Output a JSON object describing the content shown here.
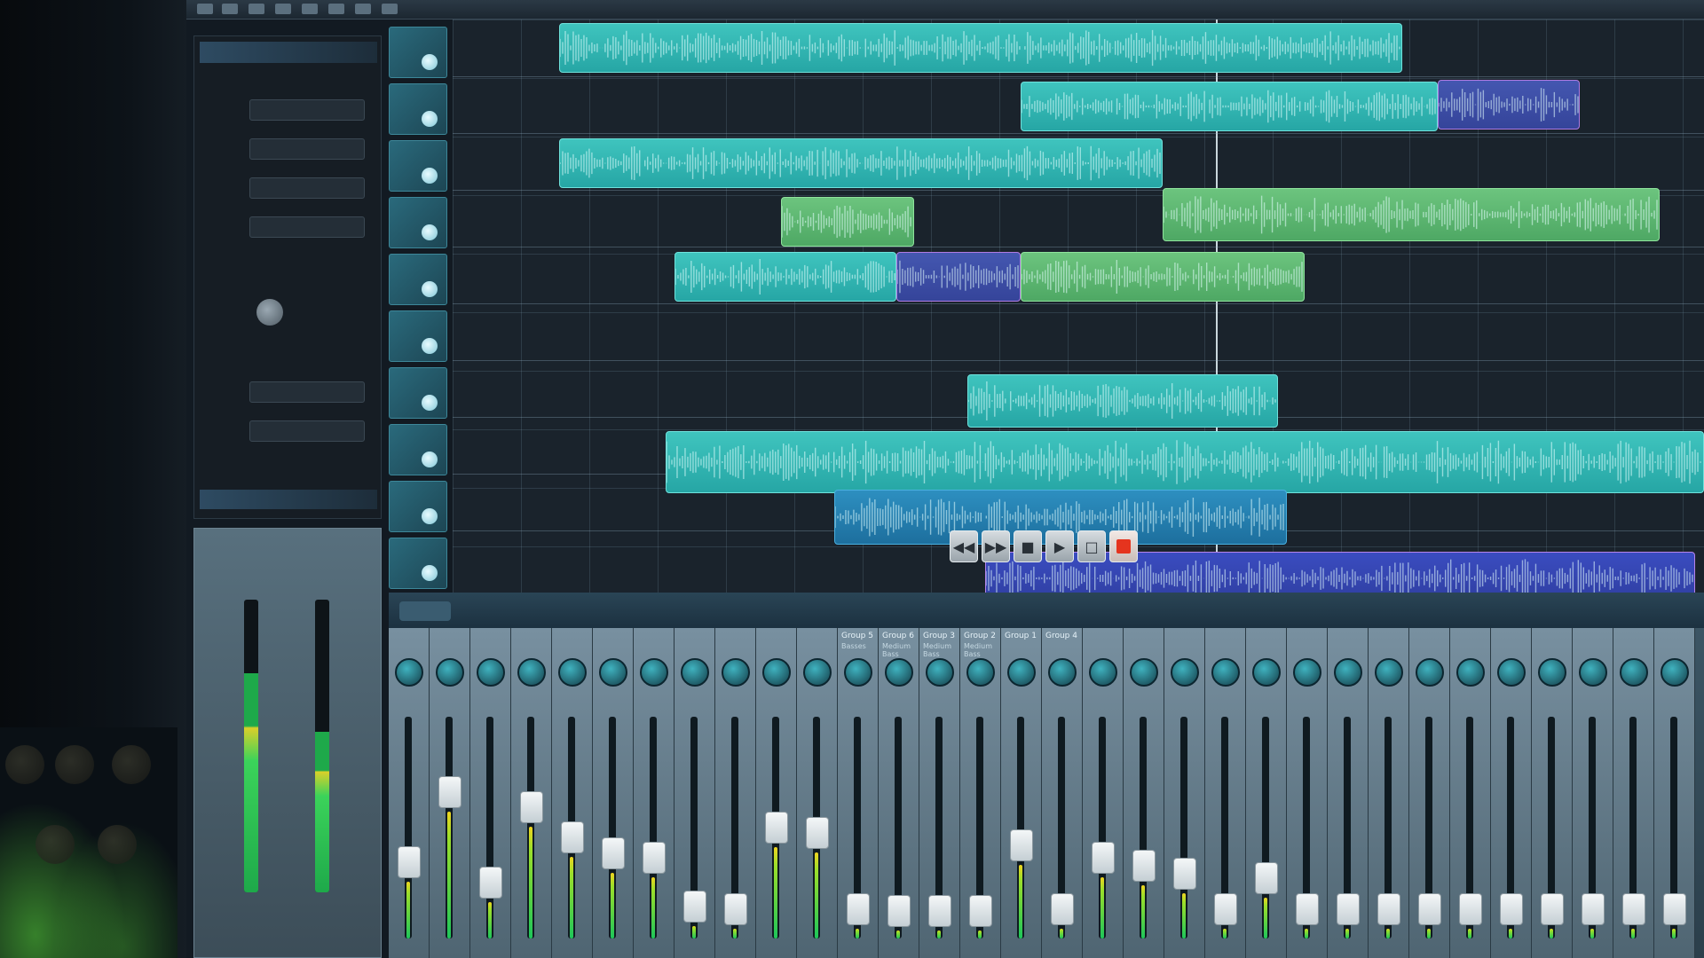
{
  "colors": {
    "teal_clip": "#3fc4be",
    "green_clip": "#6cc47e",
    "blue_clip": "#2d8fc0",
    "midi_clip": "#4457b0",
    "record": "#e5341e",
    "playhead": "#e9f6fb"
  },
  "inspector": {
    "title": "",
    "fields": [],
    "labels": [],
    "subtitle": ""
  },
  "master": {
    "labels": [],
    "meter_levels": [
      0.75,
      0.55
    ]
  },
  "tracks": [
    {
      "name": ""
    },
    {
      "name": ""
    },
    {
      "name": ""
    },
    {
      "name": ""
    },
    {
      "name": ""
    },
    {
      "name": ""
    },
    {
      "name": ""
    },
    {
      "name": ""
    },
    {
      "name": ""
    },
    {
      "name": ""
    }
  ],
  "arrange": {
    "clips": [
      {
        "name": "",
        "color": "teal"
      },
      {
        "name": "",
        "color": "teal"
      },
      {
        "name": "",
        "color": "midi"
      },
      {
        "name": "",
        "color": "teal"
      },
      {
        "name": "",
        "color": "green"
      },
      {
        "name": "",
        "color": "green"
      },
      {
        "name": "",
        "color": "teal"
      },
      {
        "name": "",
        "color": "midi"
      },
      {
        "name": "",
        "color": "green"
      },
      {
        "name": "",
        "color": "teal"
      },
      {
        "name": "",
        "color": "teal"
      },
      {
        "name": "",
        "color": "blue"
      },
      {
        "name": "",
        "color": "lav"
      }
    ]
  },
  "transport": {
    "buttons": [
      {
        "icon": "rewind-icon",
        "glyph": "◀◀"
      },
      {
        "icon": "fast-forward-icon",
        "glyph": "▶▶"
      },
      {
        "icon": "stop-icon",
        "glyph": "■"
      },
      {
        "icon": "play-icon",
        "glyph": "▶"
      },
      {
        "icon": "cycle-icon",
        "glyph": "□"
      },
      {
        "icon": "record-icon",
        "glyph": ""
      }
    ]
  },
  "mixer": {
    "title": "",
    "channels": [
      {
        "name": "",
        "sub": "",
        "level": 0.28
      },
      {
        "name": "",
        "sub": "",
        "level": 0.62
      },
      {
        "name": "",
        "sub": "",
        "level": 0.18
      },
      {
        "name": "",
        "sub": "",
        "level": 0.55
      },
      {
        "name": "",
        "sub": "",
        "level": 0.4
      },
      {
        "name": "",
        "sub": "",
        "level": 0.32
      },
      {
        "name": "",
        "sub": "",
        "level": 0.3
      },
      {
        "name": "",
        "sub": "",
        "level": 0.06
      },
      {
        "name": "",
        "sub": "",
        "level": 0.05
      },
      {
        "name": "",
        "sub": "",
        "level": 0.45
      },
      {
        "name": "",
        "sub": "",
        "level": 0.42
      },
      {
        "name": "Group 5",
        "sub": "Basses",
        "level": 0.05
      },
      {
        "name": "Group 6",
        "sub": "Medium Bass",
        "level": 0.04
      },
      {
        "name": "Group 3",
        "sub": "Medium Bass",
        "level": 0.04
      },
      {
        "name": "Group 2",
        "sub": "Medium Bass",
        "level": 0.04
      },
      {
        "name": "Group 1",
        "sub": "",
        "level": 0.36
      },
      {
        "name": "Group 4",
        "sub": "",
        "level": 0.05
      },
      {
        "name": "",
        "sub": "",
        "level": 0.3
      },
      {
        "name": "",
        "sub": "",
        "level": 0.26
      },
      {
        "name": "",
        "sub": "",
        "level": 0.22
      },
      {
        "name": "",
        "sub": "",
        "level": 0.05
      },
      {
        "name": "",
        "sub": "",
        "level": 0.2
      },
      {
        "name": "",
        "sub": "",
        "level": 0.05
      },
      {
        "name": "",
        "sub": "",
        "level": 0.05
      },
      {
        "name": "",
        "sub": "",
        "level": 0.05
      },
      {
        "name": "",
        "sub": "",
        "level": 0.05
      },
      {
        "name": "",
        "sub": "",
        "level": 0.05
      },
      {
        "name": "",
        "sub": "",
        "level": 0.05
      },
      {
        "name": "",
        "sub": "",
        "level": 0.05
      },
      {
        "name": "",
        "sub": "",
        "level": 0.05
      },
      {
        "name": "",
        "sub": "",
        "level": 0.05
      },
      {
        "name": "",
        "sub": "",
        "level": 0.05
      }
    ]
  }
}
